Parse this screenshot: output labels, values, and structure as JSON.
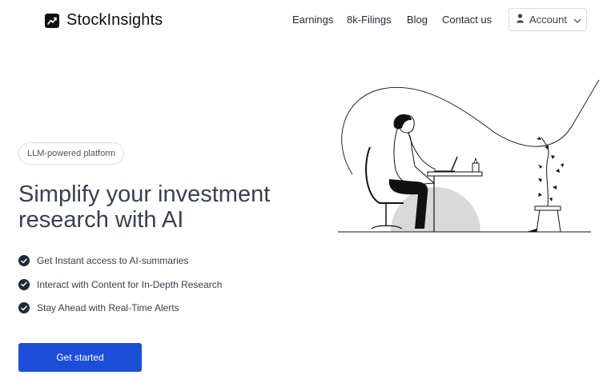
{
  "brand": {
    "name": "StockInsights",
    "icon": "trend-chart-icon"
  },
  "nav": {
    "links": [
      "Earnings",
      "8k-Filings",
      "Blog",
      "Contact us"
    ],
    "account_label": "Account"
  },
  "hero": {
    "badge": "LLM-powered platform",
    "headline_line1": "Simplify your investment",
    "headline_line2": "research with AI",
    "features": [
      "Get Instant access to AI-summaries",
      "Interact with Content for In-Depth Research",
      "Stay Ahead with Real-Time Alerts"
    ],
    "cta_label": "Get started"
  },
  "colors": {
    "primary": "#1d4ed8",
    "text": "#1f2937",
    "illustration_blob": "#d9d9d9"
  }
}
